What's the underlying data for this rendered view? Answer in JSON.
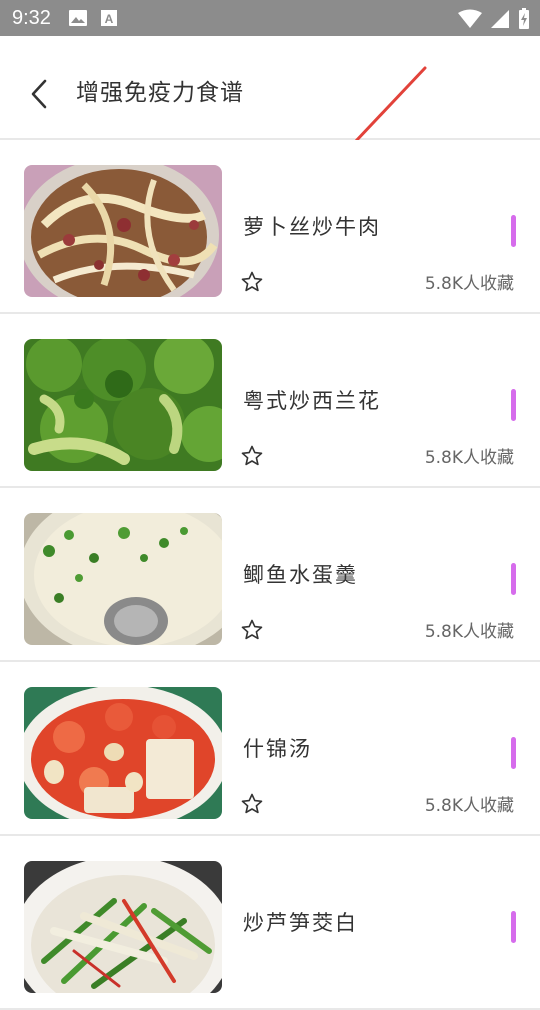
{
  "status_bar": {
    "time": "9:32",
    "icons_left": [
      "image-icon",
      "a-square-icon"
    ],
    "icons_right": [
      "wifi-icon",
      "signal-icon",
      "battery-icon"
    ]
  },
  "header": {
    "back_icon": "chevron-left-icon",
    "title": "增强免疫力食谱"
  },
  "colors": {
    "status_bar_bg": "#8c8c8c",
    "accent_bar": "#d66cec",
    "annotation_arrow": "#e2423a",
    "divider": "#e8e8e8"
  },
  "recipes": [
    {
      "name": "萝卜丝炒牛肉",
      "favorites": "5.8K人收藏",
      "image": "beef-radish-photo"
    },
    {
      "name": "粤式炒西兰花",
      "favorites": "5.8K人收藏",
      "image": "broccoli-photo"
    },
    {
      "name": "鲫鱼水蛋羹",
      "favorites": "5.8K人收藏",
      "image": "egg-custard-photo"
    },
    {
      "name": "什锦汤",
      "favorites": "5.8K人收藏",
      "image": "mixed-soup-photo"
    },
    {
      "name": "炒芦笋茭白",
      "favorites": "",
      "image": "asparagus-photo"
    }
  ]
}
